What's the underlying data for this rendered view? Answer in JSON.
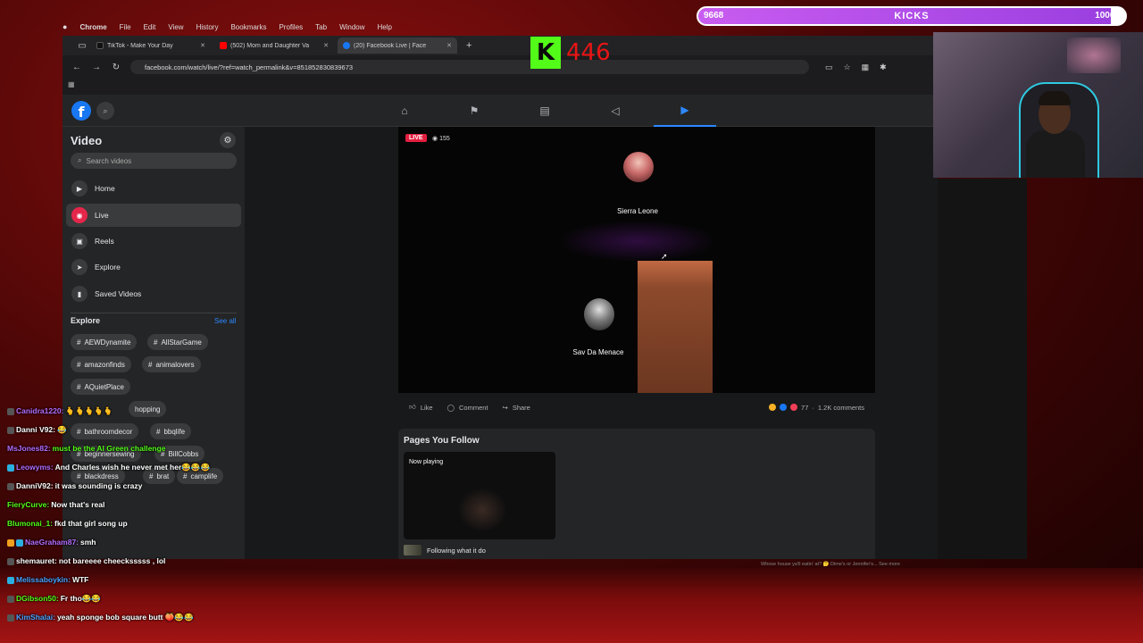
{
  "menubar": {
    "app": "Chrome",
    "items": [
      "File",
      "Edit",
      "View",
      "History",
      "Bookmarks",
      "Profiles",
      "Tab",
      "Window",
      "Help"
    ]
  },
  "tabs": [
    {
      "title": "TikTok - Make Your Day",
      "color": "#000000"
    },
    {
      "title": "(502) Mom and Daughter Va",
      "color": "#ff0000"
    },
    {
      "title": "(20) Facebook Live | Face",
      "color": "#1877f2"
    }
  ],
  "address": {
    "url": "facebook.com/watch/live/?ref=watch_permalink&v=851852830839673"
  },
  "kick": {
    "logo": "K",
    "count": "446",
    "goal_current": "9668",
    "goal_label": "KICKS",
    "goal_target": "10000",
    "goal_fraction": 0.9668
  },
  "facebook": {
    "sidebar": {
      "title": "Video",
      "search_placeholder": "Search videos",
      "items": [
        {
          "label": "Home",
          "icon": "play-icon"
        },
        {
          "label": "Live",
          "icon": "live-icon"
        },
        {
          "label": "Reels",
          "icon": "reels-icon"
        },
        {
          "label": "Explore",
          "icon": "explore-icon"
        },
        {
          "label": "Saved Videos",
          "icon": "bookmark-icon"
        }
      ],
      "explore_title": "Explore",
      "see_all": "See all",
      "chips": [
        "AEWDynamite",
        "AllStarGame",
        "amazonfinds",
        "animalovers",
        "AQuietPlace",
        "hopping",
        "bathroomdecor",
        "bbqlife",
        "beginnersewing",
        "BillCobbs",
        "blackdress",
        "brat",
        "camplife"
      ]
    },
    "video": {
      "live_badge": "LIVE",
      "viewers": "155",
      "guest_top": "Sierra Leone",
      "guest_bottom": "Sav Da Menace"
    },
    "actions": {
      "like": "Like",
      "comment": "Comment",
      "share": "Share",
      "reactions_count": "77",
      "comments_count": "1.2K comments"
    },
    "pages": {
      "title": "Pages You Follow",
      "now_playing": "Now playing",
      "following_text": "Following what it do"
    }
  },
  "caption": "Whose house ya'll eatin' at? 🤔 Dime's or Jennifer's... See more",
  "chat": [
    {
      "user": "Canidra1220:",
      "text": "🫰🫰🫰🫰🫰",
      "color": "#b46cff"
    },
    {
      "user": "Danni V92:",
      "text": "😂",
      "color": "#ffffff"
    },
    {
      "user": "MsJones82:",
      "text": "must be the Al Green challenge",
      "color": "#b46cff",
      "text_color": "#53fc18"
    },
    {
      "user": "Leowyms:",
      "text": "And Charles wish he never met her😂😂😂",
      "color": "#b46cff"
    },
    {
      "user": "DanniV92:",
      "text": "it was sounding is crazy",
      "color": "#ffffff"
    },
    {
      "user": "FieryCurve:",
      "text": "Now that's real",
      "color": "#53fc18"
    },
    {
      "user": "Blumonai_1:",
      "text": "fkd that girl song up",
      "color": "#53fc18"
    },
    {
      "user": "NaeGraham87:",
      "text": "smh",
      "color": "#b46cff"
    },
    {
      "user": "shemauret:",
      "text": "not bareeee cheecksssss , lol",
      "color": "#ffffff"
    },
    {
      "user": "Melissaboykin:",
      "text": "WTF",
      "color": "#4aa3ff"
    },
    {
      "user": "DGibson50:",
      "text": "Fr tho😂😂",
      "color": "#53fc18"
    },
    {
      "user": "KimShalai:",
      "text": "yeah sponge bob square butt 🍑😂😂",
      "color": "#4aa3ff"
    }
  ]
}
